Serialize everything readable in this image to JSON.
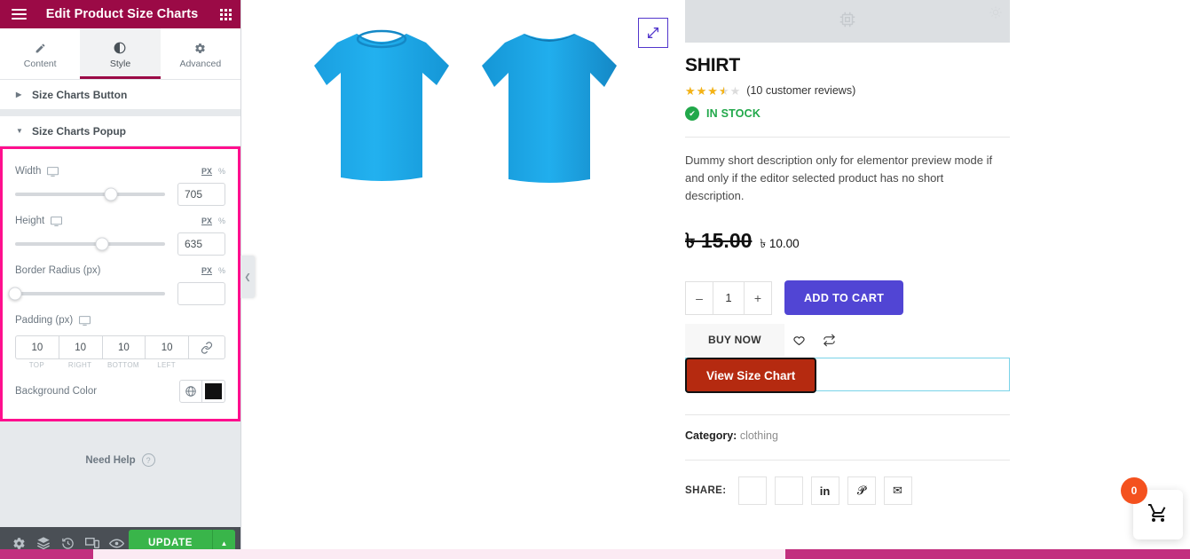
{
  "panel": {
    "title": "Edit Product Size Charts",
    "menu_icon": "hamburger-icon",
    "apps_icon": "grid-apps-icon",
    "tabs": [
      {
        "label": "Content",
        "icon": "pencil-icon",
        "active": false
      },
      {
        "label": "Style",
        "icon": "contrast-icon",
        "active": true
      },
      {
        "label": "Advanced",
        "icon": "gear-icon",
        "active": false
      }
    ],
    "sections": [
      {
        "label": "Size Charts Button",
        "expanded": false
      },
      {
        "label": "Size Charts Popup",
        "expanded": true
      }
    ],
    "controls": {
      "width": {
        "label": "Width",
        "value": "705",
        "units": [
          "PX",
          "%"
        ],
        "active_unit": "PX",
        "slider_percent": 64
      },
      "height": {
        "label": "Height",
        "value": "635",
        "units": [
          "PX",
          "%"
        ],
        "active_unit": "PX",
        "slider_percent": 58
      },
      "border_radius": {
        "label": "Border Radius (px)",
        "value": "",
        "units": [
          "PX",
          "%"
        ],
        "active_unit": "PX",
        "slider_percent": 0
      },
      "padding": {
        "label": "Padding (px)",
        "values": [
          "10",
          "10",
          "10",
          "10"
        ],
        "sides": [
          "TOP",
          "RIGHT",
          "BOTTOM",
          "LEFT"
        ],
        "link_icon": "link-chain-icon"
      },
      "background_color": {
        "label": "Background Color",
        "globe_icon": "globe-icon",
        "swatch": "#111111"
      }
    },
    "need_help": "Need Help",
    "footer": {
      "icons": [
        "gear-icon",
        "layers-navigator-icon",
        "history-clock-icon",
        "responsive-mode-icon",
        "preview-eye-icon"
      ],
      "update_label": "UPDATE",
      "update_caret_icon": "chevron-up-icon"
    },
    "collapse_icon": "chevron-left-icon",
    "highlight_color": "#ff0f8e",
    "header_color": "#9b0a46"
  },
  "preview": {
    "zoom_icon": "expand-arrows-icon",
    "gallery": {
      "images": [
        "tshirt-front-blue",
        "tshirt-back-blue"
      ],
      "color": "#1ca2e0"
    },
    "placeholder_icon": "widget-chip-icon",
    "product": {
      "title": "SHIRT",
      "rating_value": 3.5,
      "rating_max": 5,
      "reviews_text": "(10 customer reviews)",
      "stock_text": "IN STOCK",
      "stock_icon": "check-circle-icon",
      "description": "Dummy short description only for elementor preview mode if and only if the editor selected product has no short description.",
      "old_price": "৳ 15.00",
      "new_price": "৳ 10.00",
      "quantity": "1",
      "minus_label": "–",
      "plus_label": "+",
      "add_to_cart_label": "ADD TO CART",
      "add_to_cart_color": "#5145d4",
      "buy_now_label": "BUY NOW",
      "wishlist_icon": "heart-icon",
      "compare_icon": "compare-arrows-icon",
      "size_chart_label": "View Size Chart",
      "size_chart_color": "#b52a10",
      "category_label": "Category:",
      "category_value": "clothing",
      "share_label": "SHARE:",
      "share_buttons": [
        {
          "icon": "facebook-icon",
          "glyph": ""
        },
        {
          "icon": "twitter-icon",
          "glyph": ""
        },
        {
          "icon": "linkedin-icon",
          "glyph": "in"
        },
        {
          "icon": "pinterest-icon",
          "glyph": "𝓟"
        },
        {
          "icon": "email-icon",
          "glyph": "✉"
        }
      ]
    },
    "cart_widget": {
      "count": "0",
      "icon": "shopping-cart-icon",
      "badge_color": "#f4511e"
    }
  }
}
